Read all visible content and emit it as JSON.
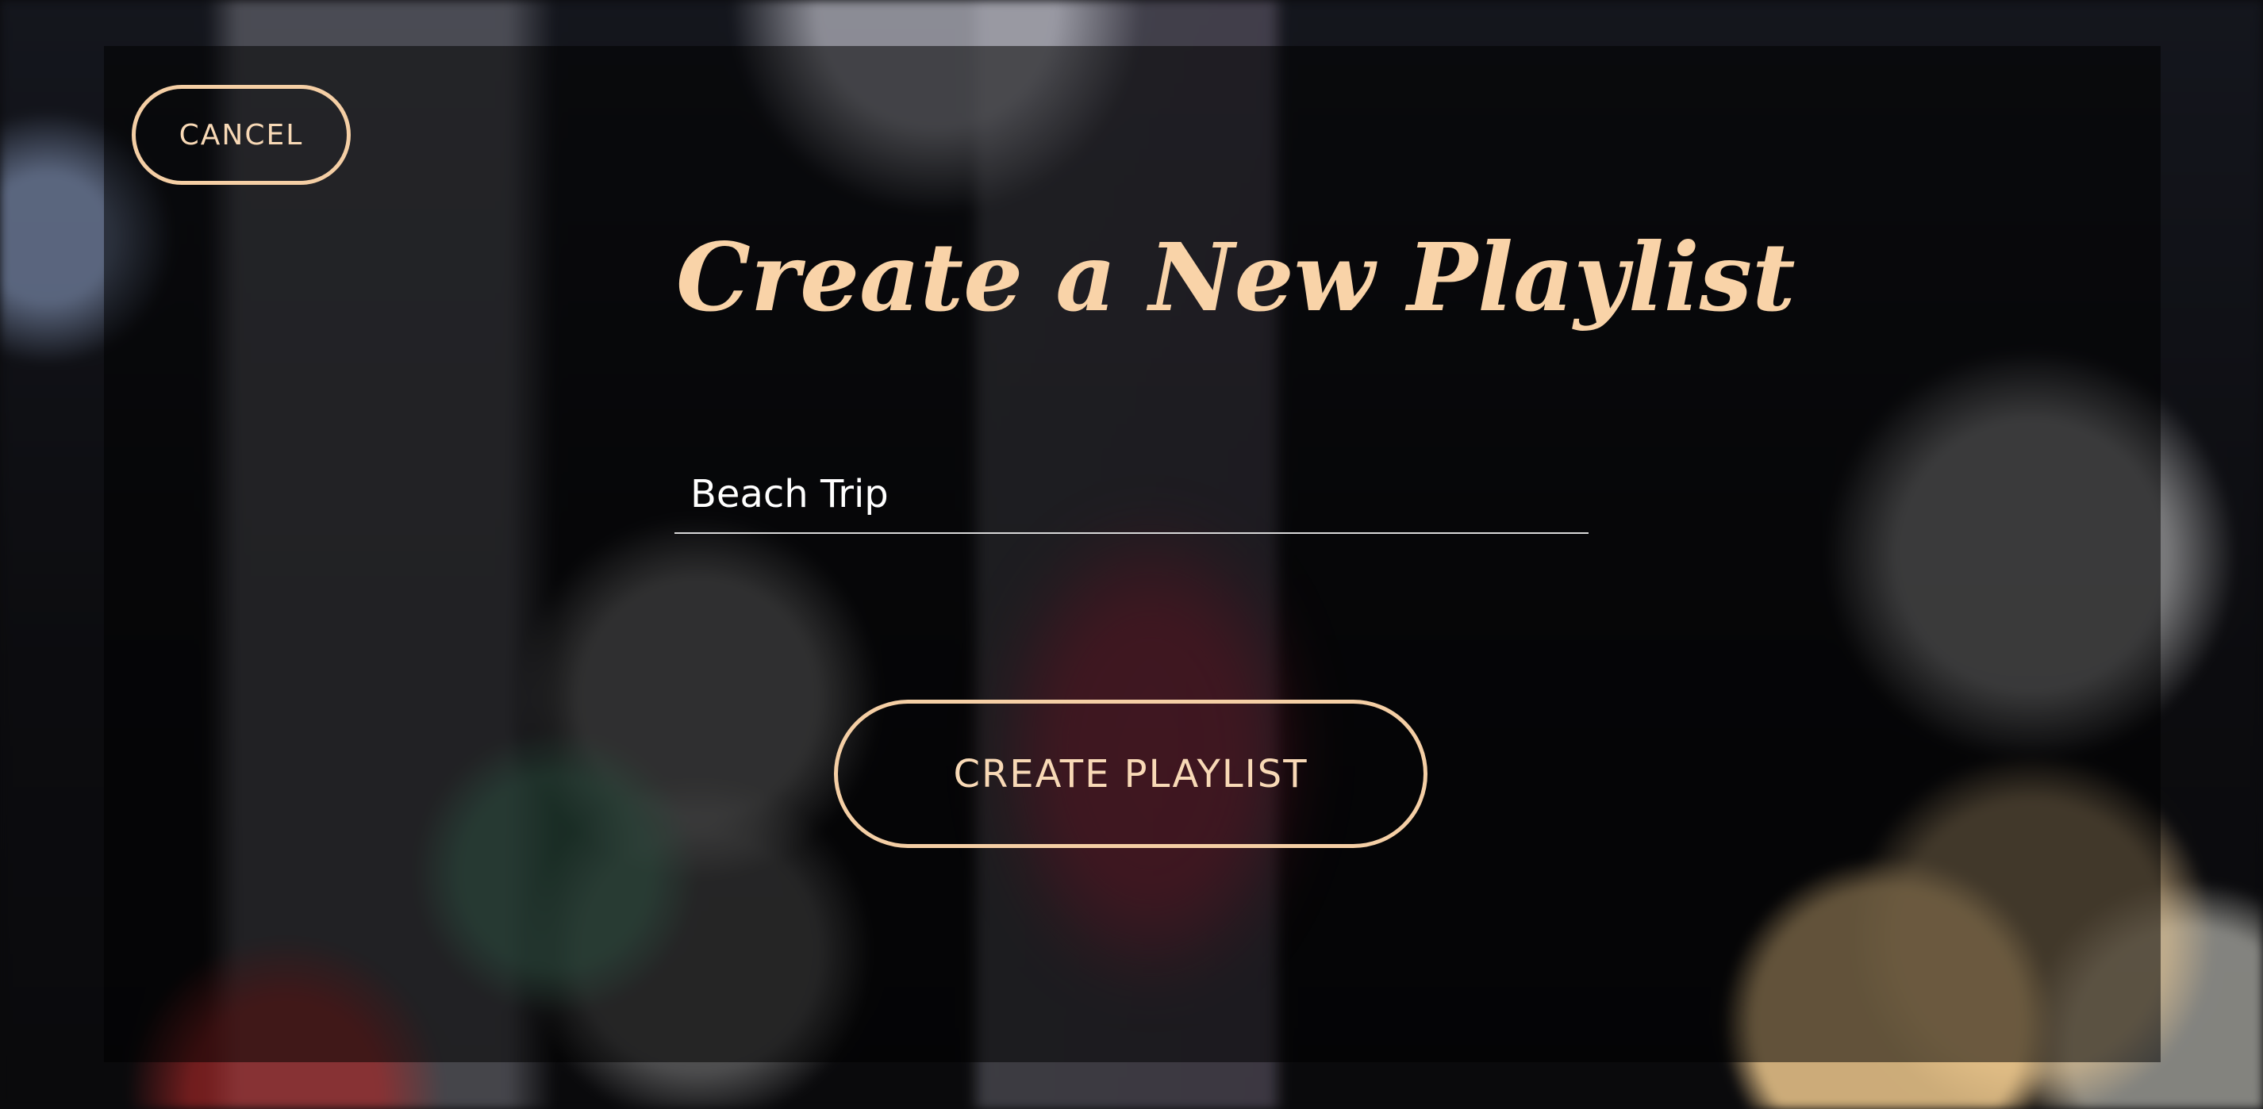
{
  "dialog": {
    "cancel_label": "CANCEL",
    "title": "Create a New Playlist",
    "name_input_value": "Beach Trip",
    "create_label": "CREATE PLAYLIST"
  },
  "colors": {
    "accent": "#f5cfa5",
    "input_text": "#ffffff",
    "underline": "#d9d9d9"
  }
}
